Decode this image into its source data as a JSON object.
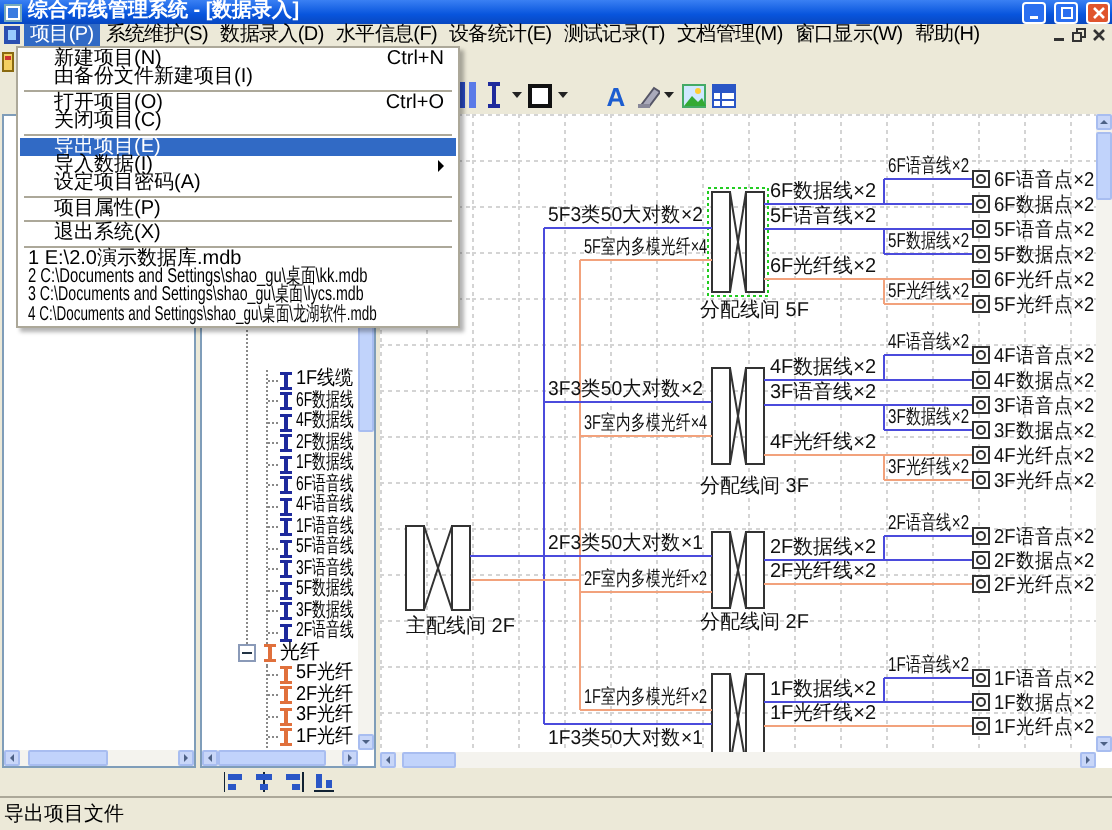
{
  "window": {
    "title": "综合布线管理系统 - [数据录入]"
  },
  "menu_bar": [
    {
      "label": "项目(P)",
      "selected": true
    },
    {
      "label": "系统维护(S)",
      "selected": false
    },
    {
      "label": "数据录入(D)",
      "selected": false
    },
    {
      "label": "水平信息(F)",
      "selected": false
    },
    {
      "label": "设备统计(E)",
      "selected": false
    },
    {
      "label": "测试记录(T)",
      "selected": false
    },
    {
      "label": "文档管理(M)",
      "selected": false
    },
    {
      "label": "窗口显示(W)",
      "selected": false
    },
    {
      "label": "帮助(H)",
      "selected": false
    }
  ],
  "toolbar": {
    "font_button": "A"
  },
  "file_menu": [
    {
      "kind": "item",
      "label": "新建项目(N)",
      "shortcut": "Ctrl+N",
      "selected": false
    },
    {
      "kind": "item",
      "label": "由备份文件新建项目(I)",
      "selected": false
    },
    {
      "kind": "separator"
    },
    {
      "kind": "item",
      "label": "打开项目(O)",
      "shortcut": "Ctrl+O",
      "selected": false
    },
    {
      "kind": "item",
      "label": "关闭项目(C)",
      "selected": false
    },
    {
      "kind": "separator"
    },
    {
      "kind": "item",
      "label": "导出项目(E)",
      "selected": true
    },
    {
      "kind": "submenu",
      "label": "导入数据(I)",
      "selected": false
    },
    {
      "kind": "item",
      "label": "设定项目密码(A)",
      "selected": false
    },
    {
      "kind": "separator"
    },
    {
      "kind": "item",
      "label": "项目属性(P)",
      "selected": false
    },
    {
      "kind": "separator"
    },
    {
      "kind": "item",
      "label": "退出系统(X)",
      "selected": false
    },
    {
      "kind": "separator"
    },
    {
      "kind": "recent",
      "label": "1 E:\\2.0演示数据库.mdb",
      "selected": false
    },
    {
      "kind": "recent",
      "label": "2 C:\\Documents and Settings\\shao_gu\\桌面\\kk.mdb",
      "selected": false
    },
    {
      "kind": "recent",
      "label": "3 C:\\Documents and Settings\\shao_gu\\桌面\\lycs.mdb",
      "selected": false
    },
    {
      "kind": "recent",
      "label": "4 C:\\Documents and Settings\\shao_gu\\桌面\\龙湖软件.mdb",
      "selected": false
    }
  ],
  "tree": {
    "items": [
      {
        "children": [
          {
            "label": "1F线缆",
            "kind": "copper"
          },
          {
            "label": "6F数据线",
            "kind": "copper"
          },
          {
            "label": "4F数据线",
            "kind": "copper"
          },
          {
            "label": "2F数据线",
            "kind": "copper"
          },
          {
            "label": "1F数据线",
            "kind": "copper"
          },
          {
            "label": "6F语音线",
            "kind": "copper"
          },
          {
            "label": "4F语音线",
            "kind": "copper"
          },
          {
            "label": "1F语音线",
            "kind": "copper"
          },
          {
            "label": "5F语音线",
            "kind": "copper"
          },
          {
            "label": "3F语音线",
            "kind": "copper"
          },
          {
            "label": "5F数据线",
            "kind": "copper"
          },
          {
            "label": "3F数据线",
            "kind": "copper"
          },
          {
            "label": "2F语音线",
            "kind": "copper"
          }
        ]
      },
      {
        "label": "光纤",
        "kind": "fiber",
        "expanded": true,
        "children": [
          {
            "label": "5F光纤",
            "kind": "fiber"
          },
          {
            "label": "2F光纤",
            "kind": "fiber"
          },
          {
            "label": "3F光纤",
            "kind": "fiber"
          },
          {
            "label": "1F光纤",
            "kind": "fiber"
          }
        ]
      }
    ]
  },
  "diagram": {
    "main_frame": {
      "label": "主配线间 2F"
    },
    "frames": [
      {
        "label": "分配线间 5F",
        "selected": true,
        "feeders": [
          {
            "label": "5F3类50大对数×2",
            "kind": "copper"
          },
          {
            "label": "5F室内多模光纤×4",
            "kind": "fiber"
          }
        ],
        "cables": [
          {
            "label": "6F语音线×2",
            "kind": "copper"
          },
          {
            "label": "6F数据线×2",
            "kind": "copper"
          },
          {
            "label": "5F语音线×2",
            "kind": "copper"
          },
          {
            "label": "5F数据线×2",
            "kind": "copper"
          },
          {
            "label": "6F光纤线×2",
            "kind": "fiber"
          },
          {
            "label": "5F光纤线×2",
            "kind": "fiber"
          }
        ],
        "outlets": [
          "6F语音点×2",
          "6F数据点×2",
          "5F语音点×2",
          "5F数据点×2",
          "6F光纤点×2",
          "5F光纤点×2"
        ]
      },
      {
        "label": "分配线间 3F",
        "selected": false,
        "feeders": [
          {
            "label": "3F3类50大对数×2",
            "kind": "copper"
          },
          {
            "label": "3F室内多模光纤×4",
            "kind": "fiber"
          }
        ],
        "cables": [
          {
            "label": "4F语音线×2",
            "kind": "copper"
          },
          {
            "label": "4F数据线×2",
            "kind": "copper"
          },
          {
            "label": "3F语音线×2",
            "kind": "copper"
          },
          {
            "label": "3F数据线×2",
            "kind": "copper"
          },
          {
            "label": "4F光纤线×2",
            "kind": "fiber"
          },
          {
            "label": "3F光纤线×2",
            "kind": "fiber"
          }
        ],
        "outlets": [
          "4F语音点×2",
          "4F数据点×2",
          "3F语音点×2",
          "3F数据点×2",
          "4F光纤点×2",
          "3F光纤点×2"
        ]
      },
      {
        "label": "分配线间 2F",
        "selected": false,
        "feeders": [
          {
            "label": "2F3类50大对数×1",
            "kind": "copper"
          },
          {
            "label": "2F室内多模光纤×2",
            "kind": "fiber"
          }
        ],
        "cables": [
          {
            "label": "2F语音线×2",
            "kind": "copper"
          },
          {
            "label": "2F数据线×2",
            "kind": "copper"
          },
          {
            "label": "2F光纤线×2",
            "kind": "fiber"
          }
        ],
        "outlets": [
          "2F语音点×2",
          "2F数据点×2",
          "2F光纤点×2"
        ]
      },
      {
        "selected": false,
        "feeders": [
          {
            "label": "1F室内多模光纤×2",
            "kind": "fiber"
          },
          {
            "label": "1F3类50大对数×1",
            "kind": "copper"
          }
        ],
        "cables": [
          {
            "label": "1F语音线×2",
            "kind": "copper"
          },
          {
            "label": "1F数据线×2",
            "kind": "copper"
          },
          {
            "label": "1F光纤线×2",
            "kind": "fiber"
          }
        ],
        "outlets": [
          "1F语音点×2",
          "1F数据点×2",
          "1F光纤点×2"
        ]
      }
    ]
  },
  "status_bar": "导出项目文件"
}
